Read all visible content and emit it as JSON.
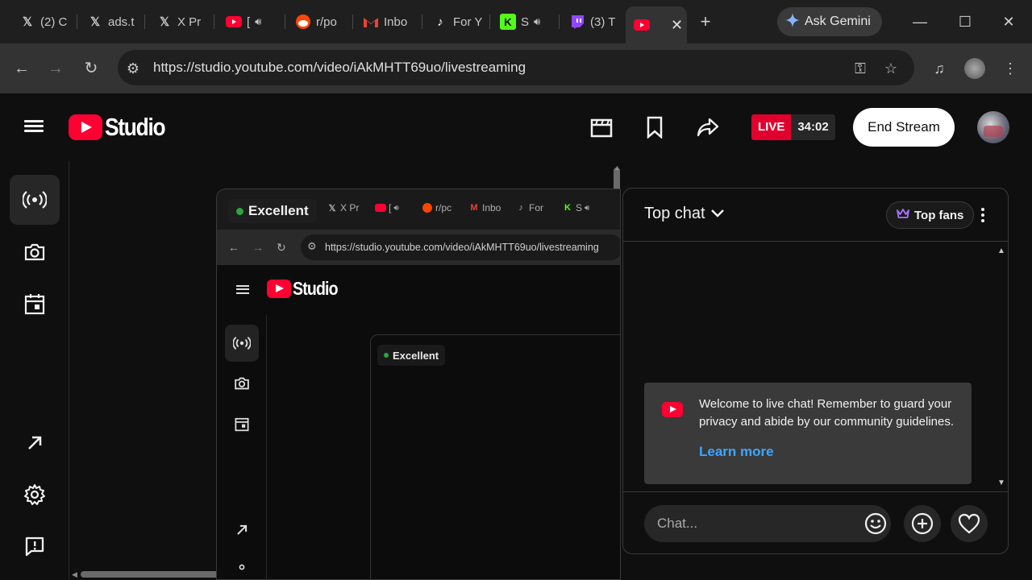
{
  "browser": {
    "tabs": [
      {
        "icon": "x-icon",
        "label": "(2) C",
        "audio": false
      },
      {
        "icon": "x-icon",
        "label": "ads.t",
        "audio": false
      },
      {
        "icon": "x-icon",
        "label": "X Pr",
        "audio": false
      },
      {
        "icon": "youtube-icon",
        "label": "[",
        "audio": true
      },
      {
        "icon": "reddit-icon",
        "label": "r/po",
        "audio": false
      },
      {
        "icon": "gmail-icon",
        "label": "Inbo",
        "audio": false
      },
      {
        "icon": "tiktok-icon",
        "label": "For Y",
        "audio": false
      },
      {
        "icon": "kick-icon",
        "label": "S",
        "audio": true
      },
      {
        "icon": "twitch-icon",
        "label": "(3) T",
        "audio": false
      },
      {
        "icon": "youtube-studio-icon",
        "label": "",
        "audio": false,
        "active": true
      }
    ],
    "ask_gemini": "Ask Gemini",
    "url": "https://studio.youtube.com/video/iAkMHTT69uo/livestreaming"
  },
  "studio": {
    "logo_text": "Studio",
    "live_label": "LIVE",
    "live_time": "34:02",
    "end_stream": "End Stream"
  },
  "preview": {
    "status": "Excellent",
    "nested_tabs": [
      "X Pr",
      "[",
      "r/pc",
      "Inbo",
      "For",
      "S"
    ],
    "nested_url": "https://studio.youtube.com/video/iAkMHTT69uo/livestreaming",
    "nested_logo_text": "Studio",
    "nested_status": "Excellent"
  },
  "chat": {
    "title": "Top chat",
    "top_fans": "Top fans",
    "welcome_message": "Welcome to live chat! Remember to guard your privacy and abide by our community guidelines.",
    "learn_more": "Learn more",
    "input_placeholder": "Chat..."
  },
  "colors": {
    "brand_red": "#ff0033",
    "live_red": "#e1002d",
    "link_blue": "#3ea6ff",
    "status_green": "#2ba640"
  }
}
